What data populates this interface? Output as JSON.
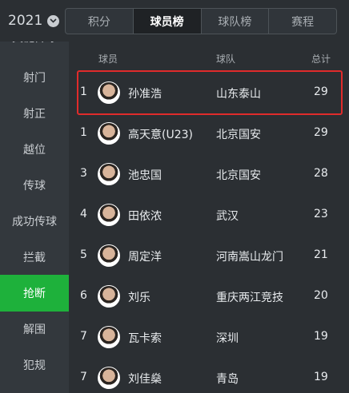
{
  "header": {
    "season": "2021",
    "tabs": [
      "积分",
      "球员榜",
      "球队榜",
      "赛程"
    ],
    "active_tab": 1
  },
  "sidebar": {
    "items": [
      "关键传球",
      "射门",
      "射正",
      "越位",
      "传球",
      "成功传球",
      "拦截",
      "抢断",
      "解围",
      "犯规"
    ],
    "active_index": 7
  },
  "table": {
    "columns": {
      "player": "球员",
      "team": "球队",
      "total": "总计"
    },
    "rows": [
      {
        "rank": "1",
        "name": "孙准浩",
        "team": "山东泰山",
        "total": "29"
      },
      {
        "rank": "1",
        "name": "高天意(U23)",
        "team": "北京国安",
        "total": "29"
      },
      {
        "rank": "3",
        "name": "池忠国",
        "team": "北京国安",
        "total": "28"
      },
      {
        "rank": "4",
        "name": "田依浓",
        "team": "武汉",
        "total": "23"
      },
      {
        "rank": "5",
        "name": "周定洋",
        "team": "河南嵩山龙门",
        "total": "21"
      },
      {
        "rank": "6",
        "name": "刘乐",
        "team": "重庆两江竞技",
        "total": "20"
      },
      {
        "rank": "7",
        "name": "瓦卡索",
        "team": "深圳",
        "total": "19"
      },
      {
        "rank": "7",
        "name": "刘佳燊",
        "team": "青岛",
        "total": "19"
      }
    ]
  },
  "colors": {
    "accent": "#1eb13b",
    "highlight": "#e02b2b"
  }
}
